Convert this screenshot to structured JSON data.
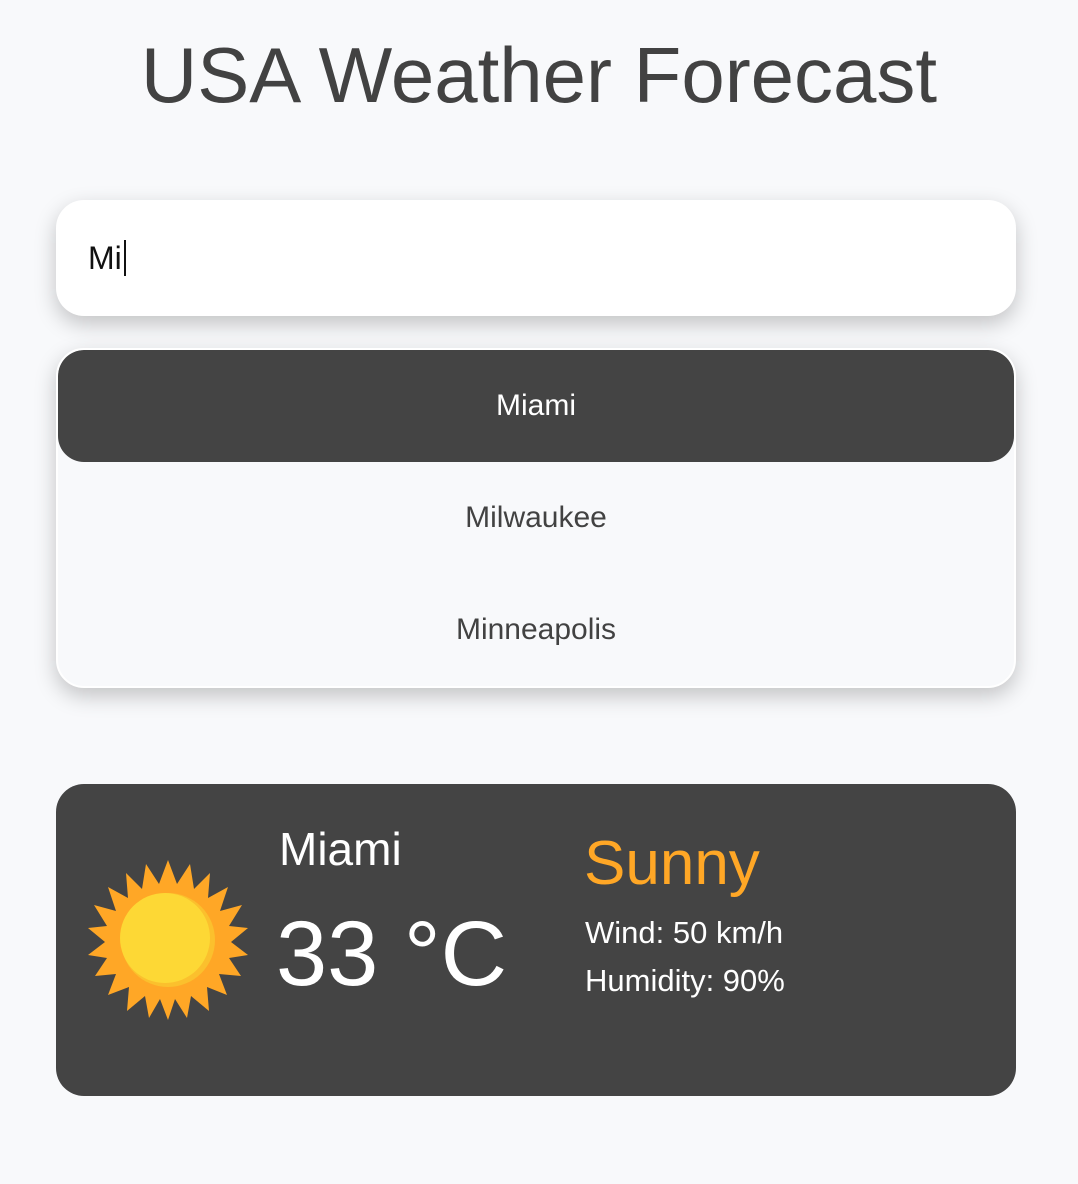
{
  "page": {
    "title": "USA Weather Forecast"
  },
  "search": {
    "value": "Mi"
  },
  "suggestions": [
    {
      "label": "Miami",
      "active": true
    },
    {
      "label": "Milwaukee",
      "active": false
    },
    {
      "label": "Minneapolis",
      "active": false
    }
  ],
  "weather": {
    "city": "Miami",
    "temperature": "33 °C",
    "condition": "Sunny",
    "wind": "Wind: 50 km/h",
    "humidity": "Humidity: 90%",
    "icon": "sun-icon"
  },
  "colors": {
    "background": "#f8f9fb",
    "card": "#444444",
    "accent": "#ffa726",
    "sun_core": "#fdd835"
  }
}
